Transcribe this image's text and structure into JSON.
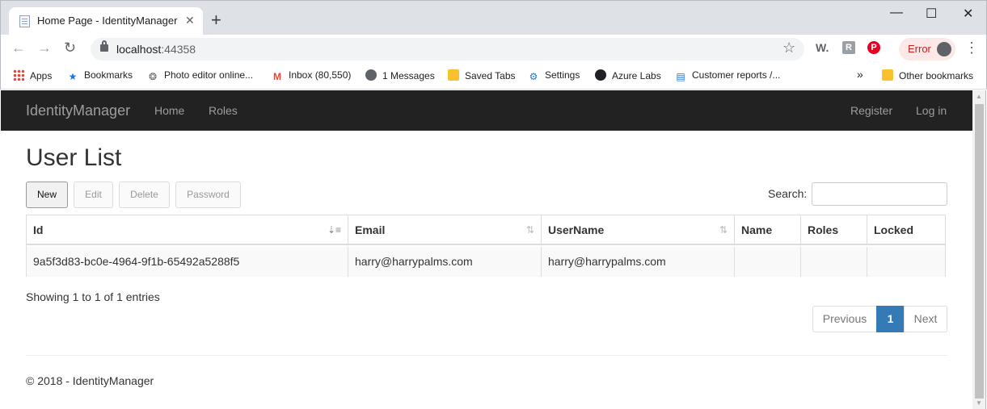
{
  "browser": {
    "tab_title": "Home Page - IdentityManager",
    "tab_close": "✕",
    "new_tab": "+",
    "window": {
      "minimize": "—",
      "maximize": "☐",
      "close": "✕"
    },
    "nav": {
      "back": "←",
      "forward": "→",
      "reload": "↻"
    },
    "url_host": "localhost",
    "url_port": ":44358",
    "star": "☆",
    "extensions": [
      "W.",
      "R",
      "P"
    ],
    "error_label": "Error",
    "menu": "⋮"
  },
  "bookmarks": {
    "items": [
      {
        "label": "Apps",
        "icon": "apps-grid-icon"
      },
      {
        "label": "Bookmarks",
        "icon": "star-icon"
      },
      {
        "label": "Photo editor online...",
        "icon": "photo-editor-icon"
      },
      {
        "label": "Inbox (80,550)",
        "icon": "gmail-icon"
      },
      {
        "label": "1 Messages",
        "icon": "globe-icon"
      },
      {
        "label": "Saved Tabs",
        "icon": "folder-icon"
      },
      {
        "label": "Settings",
        "icon": "gear-icon"
      },
      {
        "label": "Azure Labs",
        "icon": "github-icon"
      },
      {
        "label": "Customer reports /...",
        "icon": "report-icon"
      }
    ],
    "overflow": "»",
    "other": "Other bookmarks"
  },
  "navbar": {
    "brand": "IdentityManager",
    "links": [
      "Home",
      "Roles"
    ],
    "right_links": [
      "Register",
      "Log in"
    ]
  },
  "page": {
    "title": "User List",
    "buttons": {
      "new": "New",
      "edit": "Edit",
      "delete": "Delete",
      "password": "Password"
    },
    "search_label": "Search:",
    "table": {
      "headers": [
        "Id",
        "Email",
        "UserName",
        "Name",
        "Roles",
        "Locked"
      ],
      "rows": [
        [
          "9a5f3d83-bc0e-4964-9f1b-65492a5288f5",
          "harry@harrypalms.com",
          "harry@harrypalms.com",
          "",
          "",
          ""
        ]
      ]
    },
    "info": "Showing 1 to 1 of 1 entries",
    "pagination": {
      "previous": "Previous",
      "current": "1",
      "next": "Next"
    },
    "footer": "© 2018 - IdentityManager"
  },
  "colors": {
    "navbar": "#222222",
    "pager_active": "#337ab7",
    "error_chip": "#fce8e6"
  }
}
